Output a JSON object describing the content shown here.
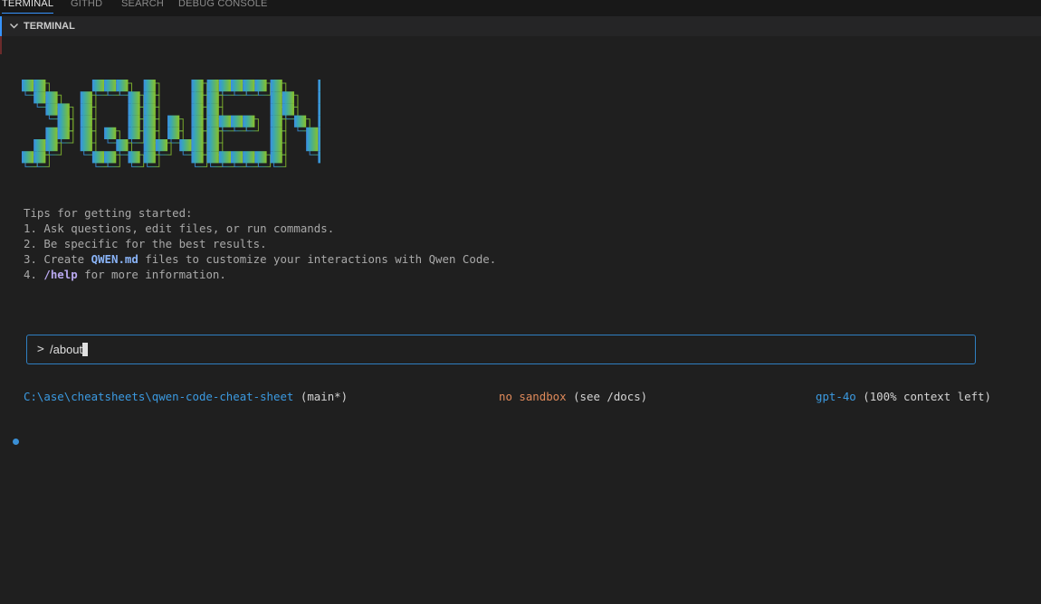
{
  "tabs": [
    {
      "label": "TERMINAL",
      "active": true
    },
    {
      "label": "GITHD",
      "active": false
    },
    {
      "label": "SEARCH",
      "active": false
    },
    {
      "label": "DEBUG CONSOLE",
      "active": false
    }
  ],
  "panel": {
    "title": "TERMINAL"
  },
  "logo": {
    "glyph_prompt": "›",
    "text": "QWEN",
    "gradient": [
      "#3a8ee6",
      "#3aa7b4",
      "#5eb56a",
      "#8ac22a"
    ]
  },
  "tips": {
    "heading": "Tips for getting started:",
    "line1": "1. Ask questions, edit files, or run commands.",
    "line2": "2. Be specific for the best results.",
    "line3_pre": "3. Create ",
    "line3_file": "QWEN.md",
    "line3_post": " files to customize your interactions with Qwen Code.",
    "line4_pre": "4. ",
    "line4_cmd": "/help",
    "line4_post": " for more information."
  },
  "prompt": {
    "chevron": ">",
    "value": "/about"
  },
  "status": {
    "path": "C:\\ase\\cheatsheets\\qwen-code-cheat-sheet",
    "branch": "(main*)",
    "sandbox": "no sandbox",
    "sandbox_hint": "(see /docs)",
    "model": "gpt-4o",
    "context": "(100% context left)"
  },
  "colors": {
    "accent": "#3794ff",
    "path": "#3b9ae1",
    "sandbox": "#e08a5a"
  }
}
